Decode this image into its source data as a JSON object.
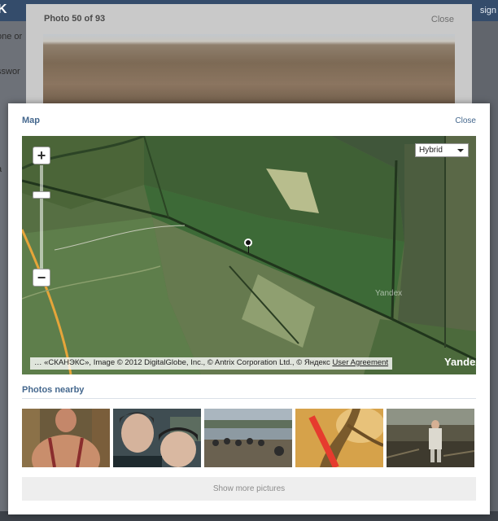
{
  "background": {
    "logo": "K",
    "user_text": "sign",
    "side_texts": [
      "one or",
      "sswor",
      "a"
    ]
  },
  "photo_viewer": {
    "counter": "Photo 50 of 93",
    "close_label": "Close"
  },
  "map_dialog": {
    "title": "Map",
    "close_label": "Close",
    "map": {
      "zoom_in": "+",
      "zoom_out": "−",
      "layer_select_value": "Hybrid",
      "watermark": "Yandex",
      "copyright_text": "… «СКАНЭКС», Image © 2012 DigitalGlobe, Inc., © Antrix Corporation Ltd., © Яндекс ",
      "copyright_link": "User Agreement",
      "logo": "Yandex"
    },
    "nearby_title": "Photos nearby",
    "thumbnails": [
      {
        "name": "thumb-shirtless-man"
      },
      {
        "name": "thumb-two-boys-selfie"
      },
      {
        "name": "thumb-motorcycles-by-river"
      },
      {
        "name": "thumb-orange-tree"
      },
      {
        "name": "thumb-person-in-swamp"
      }
    ],
    "show_more_label": "Show more pictures"
  },
  "colors": {
    "accent": "#45688e",
    "topbar": "#344c6b"
  }
}
